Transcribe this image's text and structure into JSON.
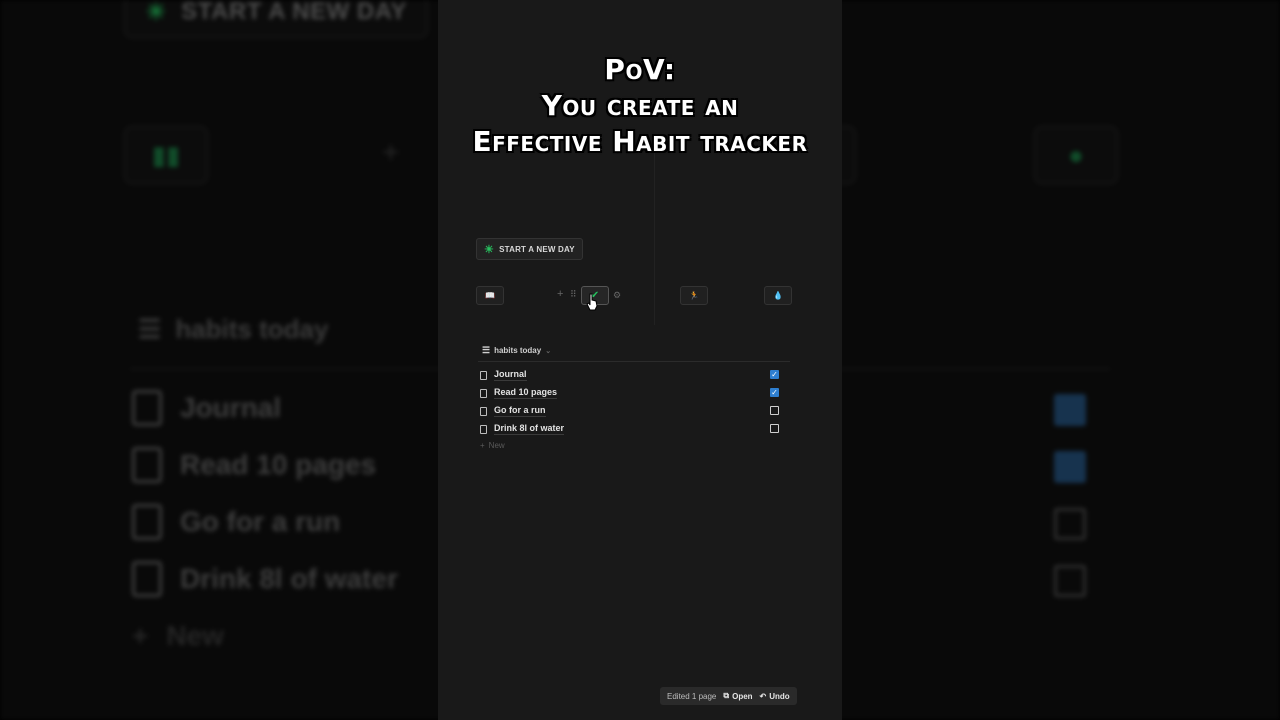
{
  "caption": {
    "line1": "PoV:",
    "line2": "You create an",
    "line3": "Effective Habit tracker"
  },
  "start_day_label": "START A NEW DAY",
  "habit_buttons": [
    {
      "icon": "book-icon",
      "glyph": "📖"
    },
    {
      "icon": "checklist-icon",
      "glyph": "✔"
    },
    {
      "icon": "run-icon",
      "glyph": "🏃"
    },
    {
      "icon": "water-drop-icon",
      "glyph": "💧"
    }
  ],
  "database": {
    "title": "habits today",
    "rows": [
      {
        "title": "Journal",
        "checked": true
      },
      {
        "title": "Read 10 pages",
        "checked": true
      },
      {
        "title": "Go for a run",
        "checked": false
      },
      {
        "title": "Drink 8l of water",
        "checked": false
      }
    ],
    "new_label": "New"
  },
  "toast": {
    "message": "Edited 1 page",
    "open_label": "Open",
    "undo_label": "Undo"
  },
  "colors": {
    "accent_green": "#27c15f",
    "checkbox_blue": "#2e7fd1",
    "panel_bg": "#191919"
  }
}
